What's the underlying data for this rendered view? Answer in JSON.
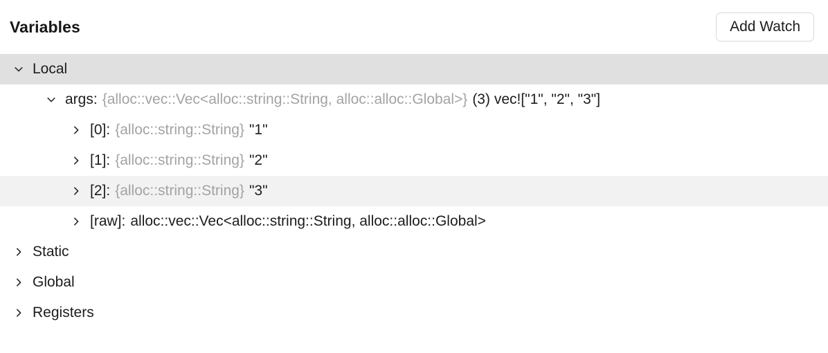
{
  "header": {
    "title": "Variables",
    "add_watch_label": "Add Watch"
  },
  "colors": {
    "background": "#ffffff",
    "text": "#1c1c1c",
    "type_text": "#a3a3a3",
    "selected_row": "#e0e0e0",
    "hovered_row": "#f2f2f2",
    "button_border": "#d9d9d9"
  },
  "tree": {
    "rows": [
      {
        "id": "local",
        "depth": 0,
        "expanded": true,
        "state": "selected",
        "chevron": "chevron-down-icon",
        "label": "Local",
        "type": "",
        "value": ""
      },
      {
        "id": "args",
        "depth": 1,
        "expanded": true,
        "state": "normal",
        "chevron": "chevron-down-icon",
        "label": "args:",
        "type": "{alloc::vec::Vec<alloc::string::String, alloc::alloc::Global>}",
        "value": "(3) vec![\"1\", \"2\", \"3\"]"
      },
      {
        "id": "item-0",
        "depth": 2,
        "expanded": false,
        "state": "normal",
        "chevron": "chevron-right-icon",
        "label": "[0]:",
        "type": "{alloc::string::String}",
        "value": "\"1\""
      },
      {
        "id": "item-1",
        "depth": 2,
        "expanded": false,
        "state": "normal",
        "chevron": "chevron-right-icon",
        "label": "[1]:",
        "type": "{alloc::string::String}",
        "value": "\"2\""
      },
      {
        "id": "item-2",
        "depth": 2,
        "expanded": false,
        "state": "hovered",
        "chevron": "chevron-right-icon",
        "label": "[2]:",
        "type": "{alloc::string::String}",
        "value": "\"3\""
      },
      {
        "id": "item-raw",
        "depth": 2,
        "expanded": false,
        "state": "normal",
        "chevron": "chevron-right-icon",
        "label": "[raw]:",
        "type": "",
        "value": "alloc::vec::Vec<alloc::string::String, alloc::alloc::Global>"
      },
      {
        "id": "static",
        "depth": 0,
        "expanded": false,
        "state": "normal",
        "chevron": "chevron-right-icon",
        "label": "Static",
        "type": "",
        "value": ""
      },
      {
        "id": "global",
        "depth": 0,
        "expanded": false,
        "state": "normal",
        "chevron": "chevron-right-icon",
        "label": "Global",
        "type": "",
        "value": ""
      },
      {
        "id": "registers",
        "depth": 0,
        "expanded": false,
        "state": "normal",
        "chevron": "chevron-right-icon",
        "label": "Registers",
        "type": "",
        "value": ""
      }
    ]
  }
}
